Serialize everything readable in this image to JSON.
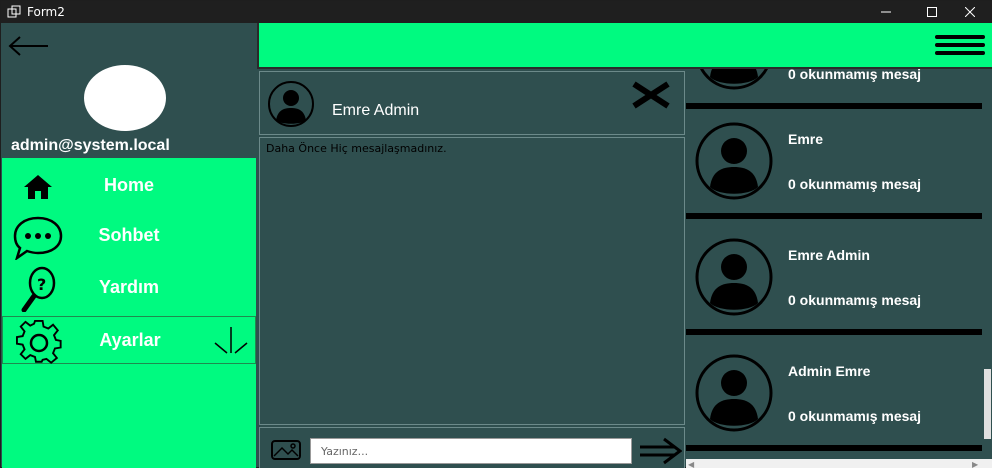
{
  "window": {
    "title": "Form2"
  },
  "sidebar": {
    "email": "admin@system.local",
    "menu": [
      {
        "label": "Home",
        "icon": "home-icon"
      },
      {
        "label": "Sohbet",
        "icon": "chat-bubble-icon"
      },
      {
        "label": "Yardım",
        "icon": "help-magnifier-icon"
      },
      {
        "label": "Ayarlar",
        "icon": "gear-icon"
      }
    ]
  },
  "chat": {
    "contact_name": "Emre Admin",
    "empty_message": "Daha Önce Hiç mesajlaşmadınız.",
    "input_placeholder": "Yazınız..."
  },
  "contacts": [
    {
      "name": "",
      "status": "0 okunmamış mesaj"
    },
    {
      "name": "Emre",
      "status": "0 okunmamış mesaj"
    },
    {
      "name": "Emre Admin",
      "status": "0 okunmamış mesaj"
    },
    {
      "name": "Admin Emre",
      "status": "0 okunmamış mesaj"
    }
  ],
  "colors": {
    "accent": "#00fa80",
    "panel": "#2f4f4f",
    "titlebar": "#1f1f1f"
  }
}
